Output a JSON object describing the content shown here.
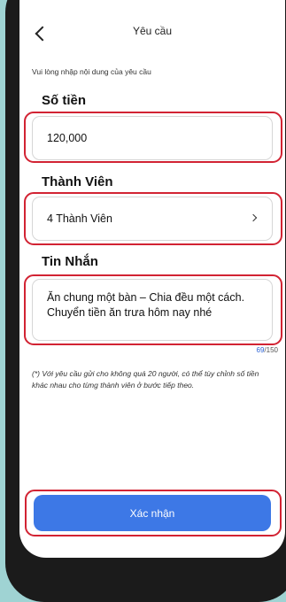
{
  "header": {
    "title": "Yêu cầu",
    "back_icon": "chevron-left-icon"
  },
  "instruction": "Vui lòng nhập nội dung của yêu cầu",
  "amount": {
    "label": "Số tiền",
    "value": "120,000"
  },
  "members": {
    "label": "Thành Viên",
    "value": "4 Thành Viên",
    "icon": "chevron-right-icon"
  },
  "message": {
    "label": "Tin Nhắn",
    "value": "Ăn chung một bàn – Chia đều một cách. Chuyển tiền ăn trưa hôm nay nhé",
    "count": "69",
    "max": "/150"
  },
  "note": "(*) Với yêu cầu gửi cho không quá 20 người, có thể tùy chỉnh số tiền khác nhau cho từng thành viên ở bước tiếp theo.",
  "confirm_label": "Xác nhận",
  "colors": {
    "accent": "#3d78e6",
    "highlight": "#d22333",
    "background": "#9fd3d3"
  }
}
